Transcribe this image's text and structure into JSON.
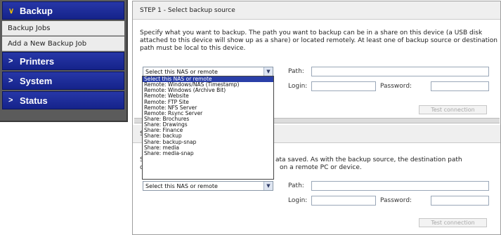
{
  "nav": {
    "backup_label": "Backup",
    "sub_items": [
      "Backup Jobs",
      "Add a New Backup Job"
    ],
    "printers_label": "Printers",
    "system_label": "System",
    "status_label": "Status"
  },
  "step1": {
    "title": "STEP 1 - Select backup source",
    "description": "Specify what you want to backup. The path you want to backup can be in a share on this device (a USB disk attached to this device will show up as a share) or located remotely. At least one of backup source or destination path must be local to this device.",
    "select_value": "Select this NAS or remote",
    "path_label": "Path:",
    "login_label": "Login:",
    "password_label": "Password:",
    "test_label": "Test connection"
  },
  "step2": {
    "title_visible": "S",
    "desc_edge_1": "S",
    "desc_edge_2": "c",
    "desc_line1": "ata saved. As with the backup source, the destination path",
    "desc_line2": "on a remote PC or device.",
    "select_value": "Select this NAS or remote",
    "path_label": "Path:",
    "login_label": "Login:",
    "password_label": "Password:",
    "test_label": "Test connection"
  },
  "dropdown": {
    "options": [
      "Select this NAS or remote",
      "Remote: Windows/NAS (Timestamp)",
      "Remote: Windows (Archive Bit)",
      "Remote: Website",
      "Remote: FTP Site",
      "Remote: NFS Server",
      "Remote: Rsync Server",
      "Share: Brochures",
      "Share: Drawings",
      "Share: Finance",
      "Share: backup",
      "Share: backup-snap",
      "Share: media",
      "Share: media-snap"
    ],
    "selected_index": 0
  },
  "colors": {
    "nav_blue": "#15238a",
    "accent_yellow": "#f2c200",
    "selection_blue": "#2a3fa8"
  },
  "icons": {
    "expanded": "chevron-down-icon",
    "collapsed": "chevron-right-icon",
    "dropdown": "dropdown-arrow-icon"
  }
}
